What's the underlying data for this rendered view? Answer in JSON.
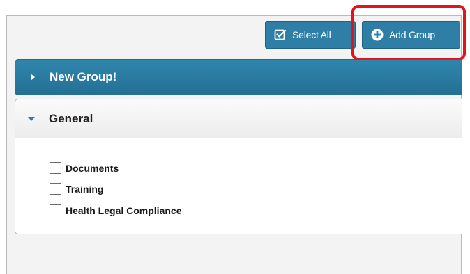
{
  "toolbar": {
    "select_all_label": "Select All",
    "add_group_label": "Add Group"
  },
  "groups": [
    {
      "title": "New Group!",
      "expanded": false
    },
    {
      "title": "General",
      "expanded": true,
      "items": [
        {
          "label": "Documents",
          "checked": false
        },
        {
          "label": "Training",
          "checked": false
        },
        {
          "label": "Health Legal Compliance",
          "checked": false
        }
      ]
    }
  ],
  "colors": {
    "accent": "#2e7ea6",
    "highlight": "#e3131b"
  },
  "icons": {
    "select_all": "checkbox-check-icon",
    "add_group": "plus-circle-icon",
    "collapsed": "caret-right-icon",
    "expanded": "caret-down-icon"
  }
}
